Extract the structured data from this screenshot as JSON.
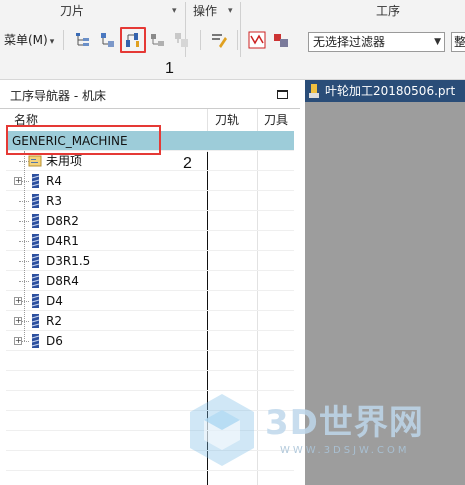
{
  "ribbon": {
    "groups": [
      {
        "label": "刀片"
      },
      {
        "label": "操作"
      },
      {
        "label": "工序"
      }
    ],
    "menu_label": "菜单(M)",
    "filter_value": "无选择过滤器",
    "clip_text": "整"
  },
  "annotations": {
    "one": "1",
    "two": "2"
  },
  "navigator": {
    "title": "工序导航器 - 机床",
    "columns": [
      "名称",
      "刀轨",
      "刀具"
    ],
    "root": "GENERIC_MACHINE",
    "items": [
      {
        "label": "未用项",
        "icon": "folder-icon",
        "expandable": false
      },
      {
        "label": "R4",
        "icon": "tool-icon",
        "expandable": true
      },
      {
        "label": "R3",
        "icon": "tool-icon",
        "expandable": false
      },
      {
        "label": "D8R2",
        "icon": "tool-icon",
        "expandable": false
      },
      {
        "label": "D4R1",
        "icon": "tool-icon",
        "expandable": false
      },
      {
        "label": "D3R1.5",
        "icon": "tool-icon",
        "expandable": false
      },
      {
        "label": "D8R4",
        "icon": "tool-icon",
        "expandable": false
      },
      {
        "label": "D4",
        "icon": "tool-icon",
        "expandable": true
      },
      {
        "label": "R2",
        "icon": "tool-icon",
        "expandable": true
      },
      {
        "label": "D6",
        "icon": "tool-icon",
        "expandable": true
      }
    ]
  },
  "document_tab": {
    "title": "叶轮加工20180506.prt"
  },
  "watermark": {
    "main": "3D世界网",
    "sub": "WWW.3DSJW.COM"
  },
  "colors": {
    "selection": "#9dccd9",
    "highlight_box": "#e53935",
    "doc_tab": "#2a4d78",
    "graphics_bg": "#9d9d9d"
  }
}
